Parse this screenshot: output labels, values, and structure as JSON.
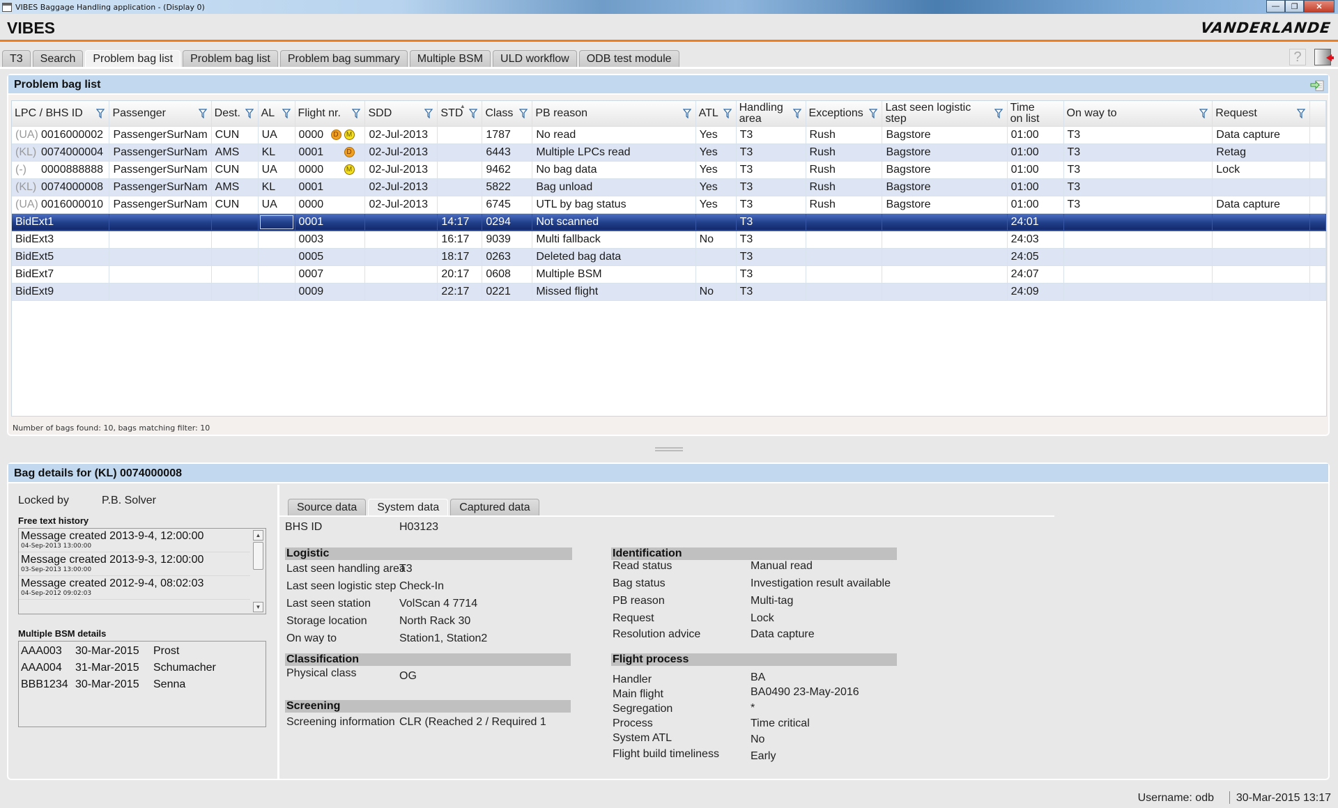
{
  "window": {
    "title": "VIBES Baggage Handling application - (Display 0)",
    "controls": {
      "minimize": "—",
      "restore": "❐",
      "close": "✕"
    }
  },
  "header": {
    "app_name": "VIBES",
    "brand": "VANDERLANDE"
  },
  "tabs": [
    {
      "label": "T3",
      "active": false
    },
    {
      "label": "Search",
      "active": false
    },
    {
      "label": "Problem bag list",
      "active": true
    },
    {
      "label": "Problem bag list",
      "active": false
    },
    {
      "label": "Problem bag summary",
      "active": false
    },
    {
      "label": "Multiple BSM",
      "active": false
    },
    {
      "label": "ULD workflow",
      "active": false
    },
    {
      "label": "ODB test module",
      "active": false
    }
  ],
  "toolbar": {
    "help_label": "?"
  },
  "problem_list": {
    "title": "Problem bag list",
    "columns": [
      {
        "label": "LPC / BHS ID",
        "filter": true
      },
      {
        "label": "Passenger",
        "filter": true
      },
      {
        "label": "Dest.",
        "filter": true
      },
      {
        "label": "AL",
        "filter": true
      },
      {
        "label": "Flight nr.",
        "filter": true
      },
      {
        "label": "SDD",
        "filter": true
      },
      {
        "label": "STD",
        "filter": true,
        "sorted": true
      },
      {
        "label": "Class",
        "filter": true
      },
      {
        "label": "PB reason",
        "filter": true
      },
      {
        "label": "ATL",
        "filter": true
      },
      {
        "label": "Handling area",
        "filter": true
      },
      {
        "label": "Exceptions",
        "filter": true
      },
      {
        "label": "Last seen logistic step",
        "filter": true
      },
      {
        "label": "Time on list",
        "filter": false
      },
      {
        "label": "On way to",
        "filter": true
      },
      {
        "label": "Request",
        "filter": true
      }
    ],
    "rows": [
      {
        "prefix": "(UA)",
        "id": "0016000002",
        "passenger": "PassengerSurNam",
        "dest": "CUN",
        "al": "UA",
        "flight": "0000",
        "badges": [
          "D",
          "M"
        ],
        "sdd": "02-Jul-2013",
        "std": "",
        "class": "1787",
        "reason": "No read",
        "atl": "Yes",
        "area": "T3",
        "exceptions": "Rush",
        "last_step": "Bagstore",
        "time_on_list": "01:00",
        "on_way_to": "T3",
        "request": "Data capture",
        "selected": false
      },
      {
        "prefix": "(KL)",
        "id": "0074000004",
        "passenger": "PassengerSurNam",
        "dest": "AMS",
        "al": "KL",
        "flight": "0001",
        "badges": [
          "",
          "D"
        ],
        "sdd": "02-Jul-2013",
        "std": "",
        "class": "6443",
        "reason": "Multiple LPCs read",
        "atl": "Yes",
        "area": "T3",
        "exceptions": "Rush",
        "last_step": "Bagstore",
        "time_on_list": "01:00",
        "on_way_to": "T3",
        "request": "Retag",
        "selected": false
      },
      {
        "prefix": "(-)",
        "id": "0000888888",
        "passenger": "PassengerSurNam",
        "dest": "CUN",
        "al": "UA",
        "flight": "0000",
        "badges": [
          "",
          "M"
        ],
        "sdd": "02-Jul-2013",
        "std": "",
        "class": "9462",
        "reason": "No bag data",
        "atl": "Yes",
        "area": "T3",
        "exceptions": "Rush",
        "last_step": "Bagstore",
        "time_on_list": "01:00",
        "on_way_to": "T3",
        "request": "Lock",
        "selected": false
      },
      {
        "prefix": "(KL)",
        "id": "0074000008",
        "passenger": "PassengerSurNam",
        "dest": "AMS",
        "al": "KL",
        "flight": "0001",
        "badges": [],
        "sdd": "02-Jul-2013",
        "std": "",
        "class": "5822",
        "reason": "Bag unload",
        "atl": "Yes",
        "area": "T3",
        "exceptions": "Rush",
        "last_step": "Bagstore",
        "time_on_list": "01:00",
        "on_way_to": "T3",
        "request": "",
        "selected": false
      },
      {
        "prefix": "(UA)",
        "id": "0016000010",
        "passenger": "PassengerSurNam",
        "dest": "CUN",
        "al": "UA",
        "flight": "0000",
        "badges": [],
        "sdd": "02-Jul-2013",
        "std": "",
        "class": "6745",
        "reason": "UTL by bag status",
        "atl": "Yes",
        "area": "T3",
        "exceptions": "Rush",
        "last_step": "Bagstore",
        "time_on_list": "01:00",
        "on_way_to": "T3",
        "request": "Data capture",
        "selected": false
      },
      {
        "prefix": "",
        "id": "BidExt1",
        "passenger": "",
        "dest": "",
        "al": "",
        "flight": "0001",
        "badges": [],
        "sdd": "",
        "std": "14:17",
        "class": "0294",
        "reason": "Not scanned",
        "atl": "",
        "area": "T3",
        "exceptions": "",
        "last_step": "",
        "time_on_list": "24:01",
        "on_way_to": "",
        "request": "",
        "selected": true
      },
      {
        "prefix": "",
        "id": "BidExt3",
        "passenger": "",
        "dest": "",
        "al": "",
        "flight": "0003",
        "badges": [],
        "sdd": "",
        "std": "16:17",
        "class": "9039",
        "reason": "Multi fallback",
        "atl": "No",
        "area": "T3",
        "exceptions": "",
        "last_step": "",
        "time_on_list": "24:03",
        "on_way_to": "",
        "request": "",
        "selected": false
      },
      {
        "prefix": "",
        "id": "BidExt5",
        "passenger": "",
        "dest": "",
        "al": "",
        "flight": "0005",
        "badges": [],
        "sdd": "",
        "std": "18:17",
        "class": "0263",
        "reason": "Deleted bag data",
        "atl": "",
        "area": "T3",
        "exceptions": "",
        "last_step": "",
        "time_on_list": "24:05",
        "on_way_to": "",
        "request": "",
        "selected": false
      },
      {
        "prefix": "",
        "id": "BidExt7",
        "passenger": "",
        "dest": "",
        "al": "",
        "flight": "0007",
        "badges": [],
        "sdd": "",
        "std": "20:17",
        "class": "0608",
        "reason": "Multiple BSM",
        "atl": "",
        "area": "T3",
        "exceptions": "",
        "last_step": "",
        "time_on_list": "24:07",
        "on_way_to": "",
        "request": "",
        "selected": false
      },
      {
        "prefix": "",
        "id": "BidExt9",
        "passenger": "",
        "dest": "",
        "al": "",
        "flight": "0009",
        "badges": [],
        "sdd": "",
        "std": "22:17",
        "class": "0221",
        "reason": "Missed flight",
        "atl": "No",
        "area": "T3",
        "exceptions": "",
        "last_step": "",
        "time_on_list": "24:09",
        "on_way_to": "",
        "request": "",
        "selected": false
      }
    ],
    "status_text": "Number of bags found:  10, bags matching filter:  10"
  },
  "details": {
    "title": "Bag details for (KL) 0074000008",
    "locked_by_label": "Locked by",
    "locked_by_value": "P.B. Solver",
    "free_text_title": "Free text history",
    "free_text": [
      {
        "message": "Message created 2013-9-4, 12:00:00",
        "timestamp": "04-Sep-2013 13:00:00"
      },
      {
        "message": "Message created 2013-9-3, 12:00:00",
        "timestamp": "03-Sep-2013 13:00:00"
      },
      {
        "message": "Message created 2012-9-4, 08:02:03",
        "timestamp": "04-Sep-2012 09:02:03"
      }
    ],
    "bsm_title": "Multiple BSM details",
    "bsm": [
      {
        "code": "AAA003",
        "date": "30-Mar-2015",
        "name": "Prost"
      },
      {
        "code": "AAA004",
        "date": "31-Mar-2015",
        "name": "Schumacher"
      },
      {
        "code": "BBB1234",
        "date": "30-Mar-2015",
        "name": "Senna"
      }
    ],
    "sub_tabs": [
      {
        "label": "Source data",
        "active": false
      },
      {
        "label": "System data",
        "active": true
      },
      {
        "label": "Captured data",
        "active": false
      }
    ],
    "bhs_id_label": "BHS ID",
    "bhs_id_value": "H03123",
    "logistic": {
      "title": "Logistic",
      "items": [
        {
          "k": "Last seen handling area",
          "v": "T3"
        },
        {
          "k": "Last seen logistic step",
          "v": "Check-In"
        },
        {
          "k": "Last seen station",
          "v": "VolScan 4 7714"
        },
        {
          "k": "Storage location",
          "v": "North Rack 30"
        },
        {
          "k": "On way to",
          "v": "Station1, Station2"
        }
      ]
    },
    "classification": {
      "title": "Classification",
      "items": [
        {
          "k": "Physical class",
          "v": "OG"
        }
      ]
    },
    "screening": {
      "title": "Screening",
      "items": [
        {
          "k": "Screening information",
          "v": "CLR (Reached 2 / Required 1"
        }
      ]
    },
    "identification": {
      "title": "Identification",
      "items": [
        {
          "k": "Read status",
          "v": "Manual read"
        },
        {
          "k": "Bag status",
          "v": "Investigation result available"
        },
        {
          "k": "PB reason",
          "v": "Multi-tag"
        },
        {
          "k": "Request",
          "v": "Lock"
        },
        {
          "k": "Resolution advice",
          "v": "Data capture"
        }
      ]
    },
    "flight_process": {
      "title": "Flight process",
      "items": [
        {
          "k": "Handler",
          "v": "BA"
        },
        {
          "k": "Main flight",
          "v": "BA0490 23-May-2016"
        },
        {
          "k": "Segregation",
          "v": "*"
        },
        {
          "k": "Process",
          "v": "Time critical"
        },
        {
          "k": "System ATL",
          "v": "No"
        },
        {
          "k": "Flight build timeliness",
          "v": "Early"
        }
      ]
    }
  },
  "footer": {
    "username": "Username: odb",
    "datetime": "30-Mar-2015 13:17"
  }
}
